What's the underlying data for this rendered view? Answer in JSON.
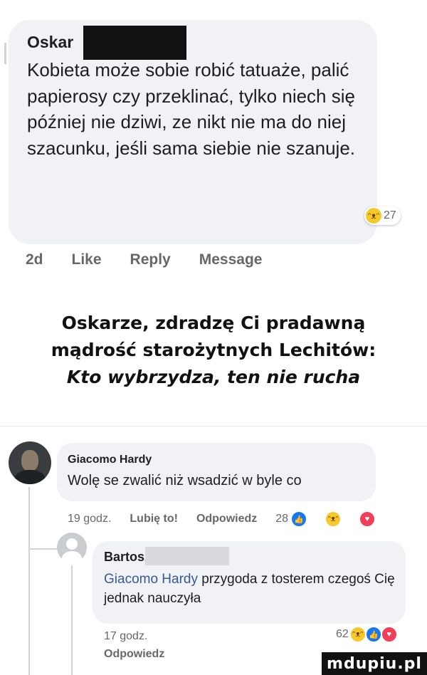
{
  "comment1": {
    "author": "Oskar",
    "text": "Kobieta może sobie robić tatuaże, palić papierosy czy przeklinać, tylko niech się później nie dziwi, ze nikt nie ma do niej szacunku, jeśli sama siebie nie szanuje.",
    "reaction_icon": "haha-emoji-icon",
    "reaction_count": "27",
    "time": "2d",
    "like": "Like",
    "reply": "Reply",
    "message": "Message"
  },
  "meme": {
    "line1": "Oskarze, zdradzę Ci pradawną",
    "line2": "mądrość starożytnych Lechitów:",
    "line3": "Kto wybrzydza, ten nie rucha"
  },
  "comment2": {
    "author": "Giacomo Hardy",
    "text": "Wolę se zwalić niż wsadzić w byle co",
    "time": "19 godz.",
    "like": "Lubię to!",
    "reply": "Odpowiedz",
    "reaction_count": "28",
    "reaction_icons": [
      "like-icon",
      "haha-icon",
      "love-icon"
    ]
  },
  "reply1": {
    "author": "Bartosz",
    "mention": "Giacomo Hardy",
    "text": " przygoda z tosterem czegoś Cię jednak nauczyła",
    "time": "17 godz.",
    "reaction_count": "62",
    "reply": "Odpowiedz"
  },
  "watermark": "mdupiu.pl"
}
